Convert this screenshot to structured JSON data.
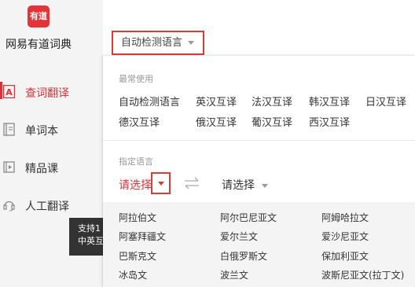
{
  "app": {
    "logo_text": "有道",
    "title": "网易有道词典"
  },
  "sidebar": {
    "items": [
      {
        "label": "查词翻译",
        "icon": "translate-icon",
        "active": true
      },
      {
        "label": "单词本",
        "icon": "wordbook-icon",
        "active": false
      },
      {
        "label": "精品课",
        "icon": "video-course-icon",
        "active": false
      },
      {
        "label": "人工翻译",
        "icon": "headset-icon",
        "active": false
      }
    ],
    "tooltip": {
      "line1": "支持1",
      "line2": "中英互"
    }
  },
  "header": {
    "language_select": "自动检测语言"
  },
  "dropdown": {
    "frequent_title": "最常使用",
    "frequent": [
      "自动检测语言",
      "英汉互译",
      "法汉互译",
      "韩汉互译",
      "日汉互译",
      "德汉互译",
      "俄汉互译",
      "葡汉互译",
      "西汉互译"
    ],
    "specify_title": "指定语言",
    "source_select": "请选择",
    "target_select": "请选择",
    "languages": [
      "阿拉伯文",
      "阿尔巴尼亚文",
      "阿姆哈拉文",
      "阿塞拜疆文",
      "爱尔兰文",
      "爱沙尼亚文",
      "巴斯克文",
      "白俄罗斯文",
      "保加利亚文",
      "冰岛文",
      "波兰文",
      "波斯尼亚文(拉丁文)"
    ]
  },
  "colors": {
    "accent": "#d5343a",
    "highlight_border": "#d93b3b",
    "sidebar_bg": "#f4f4f4"
  }
}
